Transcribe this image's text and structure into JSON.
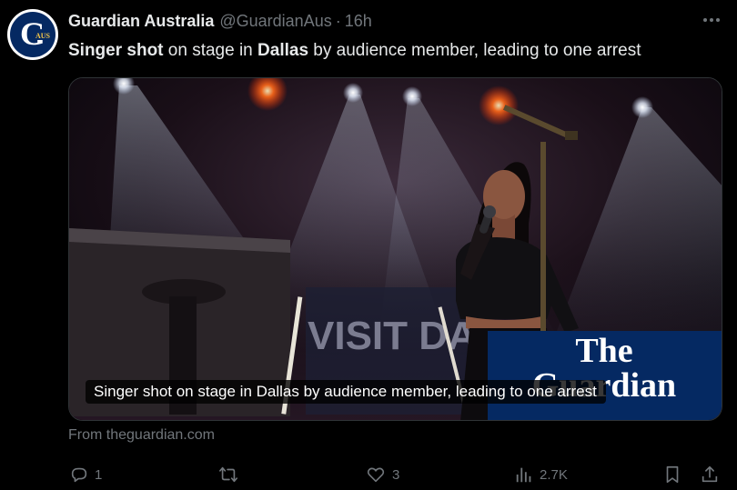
{
  "post": {
    "author": "Guardian Australia",
    "handle": "@GuardianAus",
    "separator": "·",
    "time": "16h",
    "avatar_letter": "G",
    "avatar_badge": "AUS",
    "text_parts": [
      "Singer shot",
      " on stage in ",
      "Dallas",
      " by audience member, leading to one arrest"
    ]
  },
  "card": {
    "caption": "Singer shot on stage in Dallas by audience member, leading to one arrest",
    "logo_line1": "The",
    "logo_line2": "Guardian",
    "backdrop_text": "VISIT DA",
    "domain": "From theguardian.com"
  },
  "actions": {
    "reply_count": "1",
    "repost_count": "",
    "like_count": "3",
    "views_count": "2.7K"
  },
  "colors": {
    "background": "#000000",
    "text": "#e7e9ea",
    "muted": "#71767b",
    "guardian_blue": "#052962"
  }
}
